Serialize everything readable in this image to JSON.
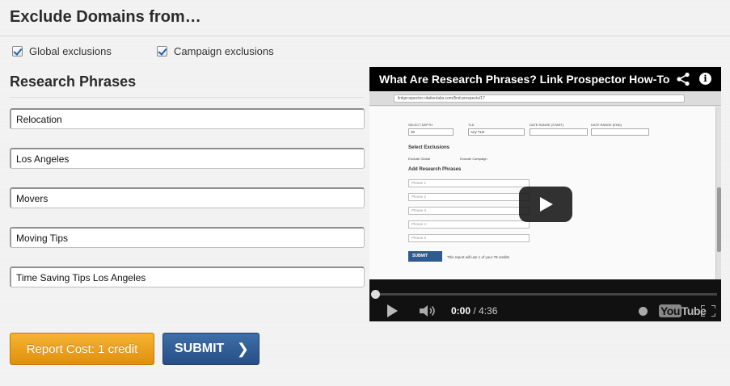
{
  "exclude": {
    "title": "Exclude Domains from…",
    "global_label": "Global exclusions",
    "global_checked": true,
    "campaign_label": "Campaign exclusions",
    "campaign_checked": true
  },
  "phrases": {
    "title": "Research Phrases",
    "items": [
      "Relocation",
      "Los Angeles",
      "Movers",
      "Moving Tips",
      "Time Saving Tips Los Angeles"
    ]
  },
  "buttons": {
    "cost_label": "Report Cost: 1 credit",
    "submit_label": "SUBMIT",
    "submit_chevron": "❯"
  },
  "video": {
    "title": "What Are Research Phrases? Link Prospector How-To",
    "info_glyph": "i",
    "current_time": "0:00",
    "duration": "/ 4:36",
    "youtube_logo_you": "You",
    "youtube_logo_tube": "Tube",
    "progress": 0,
    "inner_page": {
      "url": "linkprospector.citationlabs.com/find-prospects/17",
      "select_depth_label": "SELECT DEPTH",
      "depth_value": "20",
      "tld_label": "TLD",
      "tld_value": "Any TLD",
      "start_label": "DATE RANGE (START)",
      "end_label": "DATE RANGE (END)",
      "exclusions_title": "Select Exclusions",
      "exclude_global": "Exclude Global",
      "exclude_campaign": "Exclude Campaign",
      "add_phrases_title": "Add Research Phrases",
      "phrase_placeholders": [
        "Phrase 1",
        "Phrase 2",
        "Phrase 3",
        "Phrase 4",
        "Phrase 5"
      ],
      "submit": "SUBMIT",
      "credits_note": "This report will use 1 of your 79 credits"
    }
  }
}
